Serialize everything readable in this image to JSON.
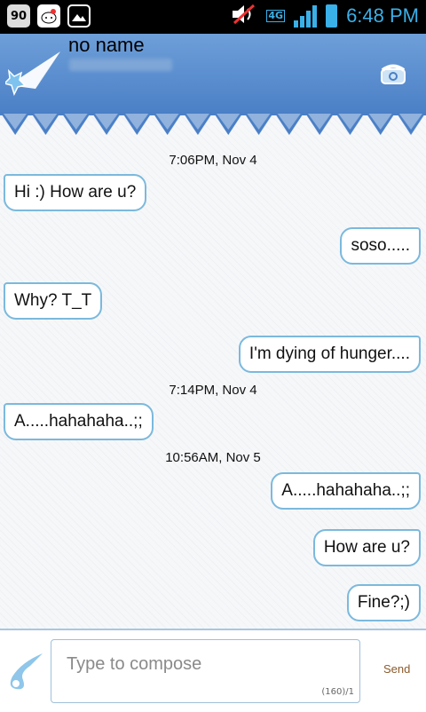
{
  "status_bar": {
    "left_icons": [
      "90",
      "hello-kitty-icon",
      "image-icon"
    ],
    "network": "4G",
    "time": "6:48 PM"
  },
  "header": {
    "contact_name": "no name"
  },
  "messages": [
    {
      "type": "timestamp",
      "text": "7:06PM, Nov 4"
    },
    {
      "type": "in",
      "text": "Hi :) How are u?"
    },
    {
      "type": "out",
      "text": "soso....."
    },
    {
      "type": "in",
      "text": "Why? T_T"
    },
    {
      "type": "out",
      "text": "I'm dying of hunger...."
    },
    {
      "type": "timestamp",
      "text": "7:14PM, Nov 4"
    },
    {
      "type": "in",
      "text": "A.....hahahaha..;;"
    },
    {
      "type": "timestamp",
      "text": "10:56AM, Nov 5"
    },
    {
      "type": "out",
      "text": "A.....hahahaha..;;"
    },
    {
      "type": "out",
      "text": "How are u?"
    },
    {
      "type": "out",
      "text": "Fine?;)"
    }
  ],
  "compose": {
    "placeholder": "Type to compose",
    "counter": "(160)/1",
    "send_label": "Send"
  },
  "colors": {
    "header": "#5b8fd0",
    "bubble_border": "#7bb9dd",
    "status_accent": "#3ab0e8"
  }
}
